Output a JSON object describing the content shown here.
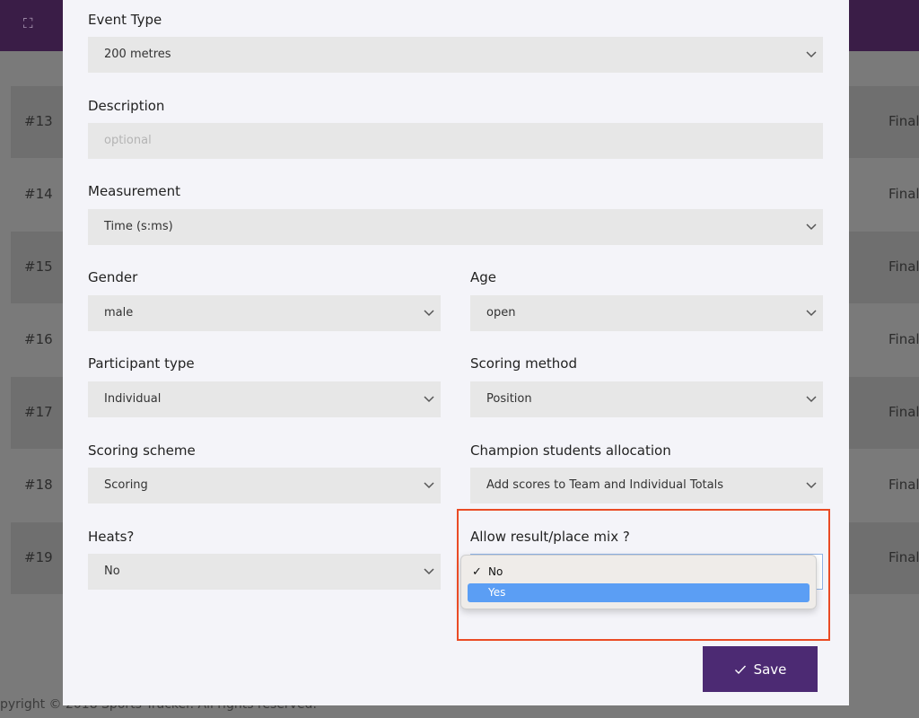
{
  "background": {
    "rows": [
      {
        "num": "#13",
        "status": "Final"
      },
      {
        "num": "#14",
        "status": "Final"
      },
      {
        "num": "#15",
        "status": "Final"
      },
      {
        "num": "#16",
        "status": "Final"
      },
      {
        "num": "#17",
        "status": "Final"
      },
      {
        "num": "#18",
        "status": "Final"
      },
      {
        "num": "#19",
        "status": "Final"
      }
    ],
    "footer": "pyright © 2018 Sports Tracker. All rights reserved."
  },
  "form": {
    "event_type": {
      "label": "Event Type",
      "value": "200 metres"
    },
    "description": {
      "label": "Description",
      "placeholder": "optional"
    },
    "measurement": {
      "label": "Measurement",
      "value": "Time (s:ms)"
    },
    "gender": {
      "label": "Gender",
      "value": "male"
    },
    "age": {
      "label": "Age",
      "value": "open"
    },
    "participant_type": {
      "label": "Participant type",
      "value": "Individual"
    },
    "scoring_method": {
      "label": "Scoring method",
      "value": "Position"
    },
    "scoring_scheme": {
      "label": "Scoring scheme",
      "value": "Scoring"
    },
    "champion_allocation": {
      "label": "Champion students allocation",
      "value": "Add scores to Team and Individual Totals"
    },
    "heats": {
      "label": "Heats?",
      "value": "No"
    },
    "result_place_mix": {
      "label": "Allow result/place mix ?",
      "options": [
        {
          "label": "No",
          "checked": true,
          "highlighted": false
        },
        {
          "label": "Yes",
          "checked": false,
          "highlighted": true
        }
      ]
    }
  },
  "save_label": "Save",
  "colors": {
    "accent": "#4c2a73",
    "highlight_border": "#ea4b25",
    "option_selected": "#5b9ef4"
  }
}
